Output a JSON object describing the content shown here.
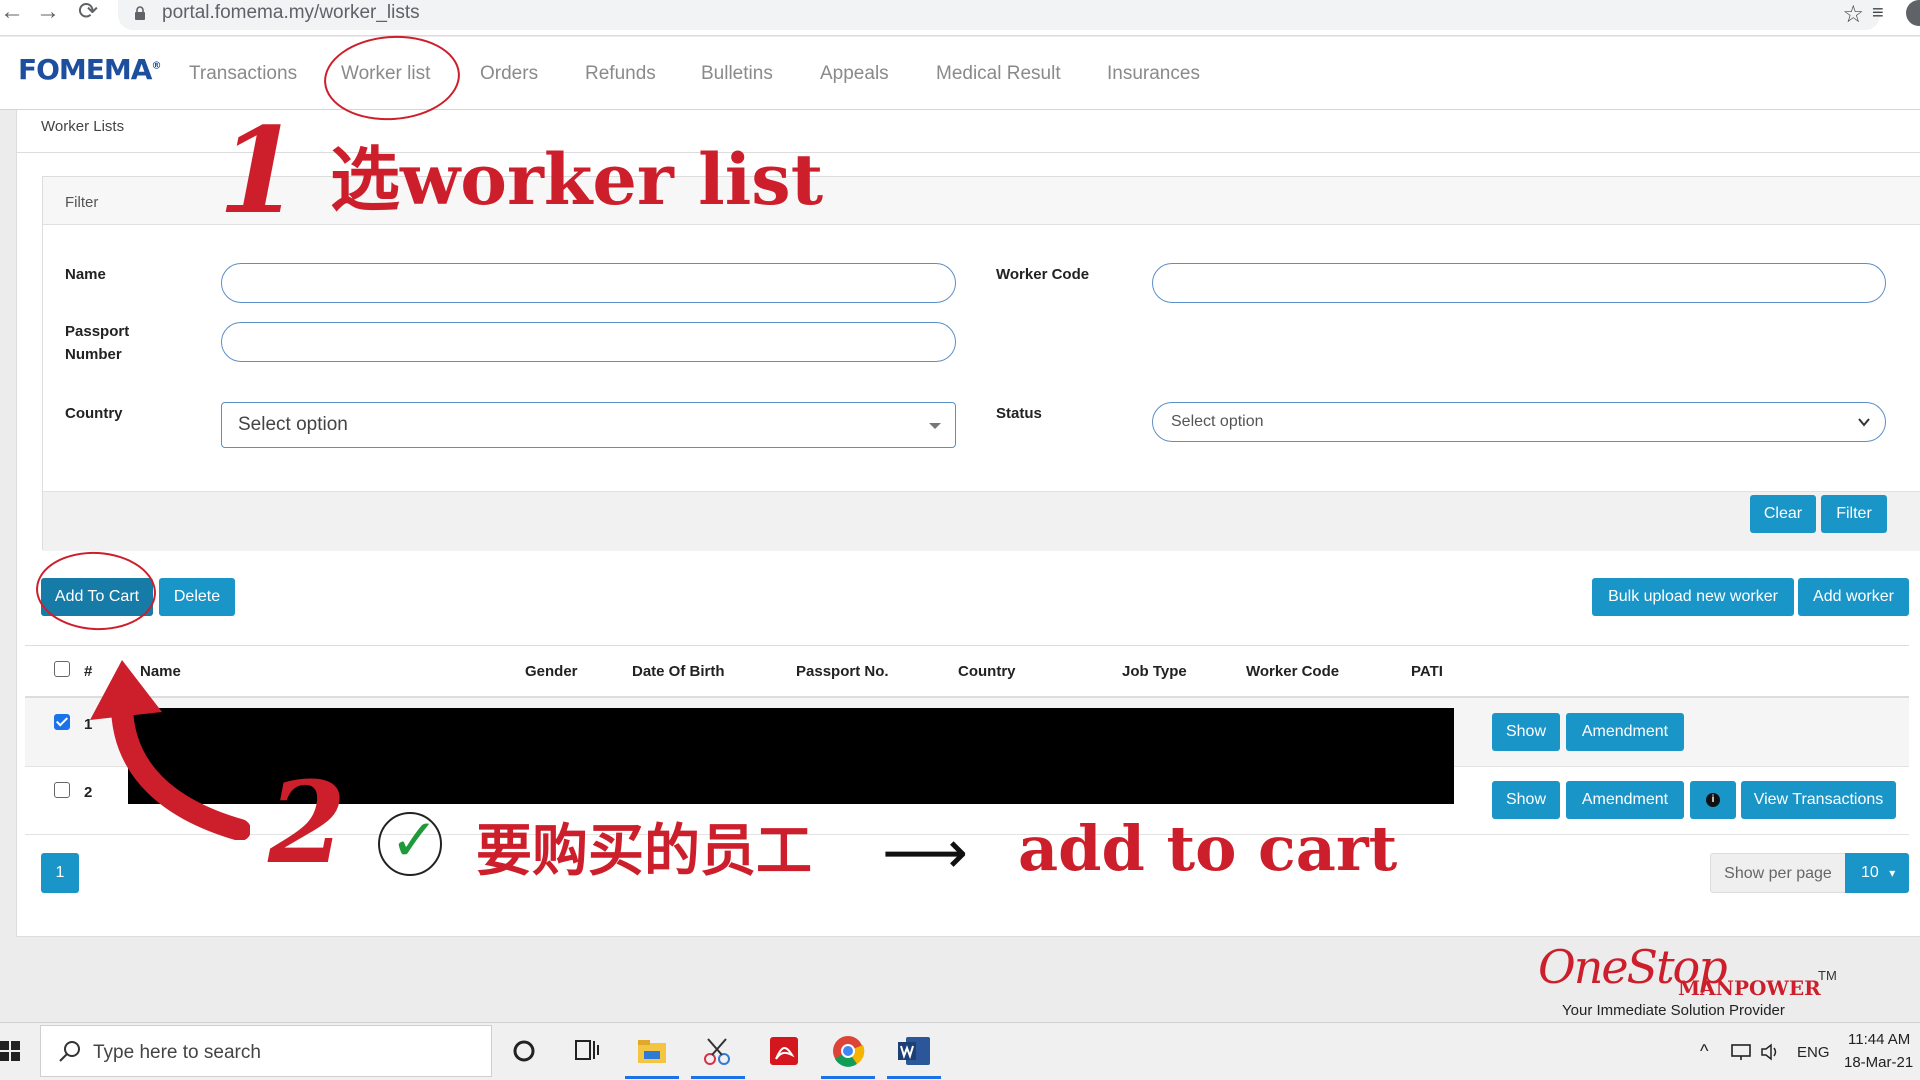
{
  "browser": {
    "back_glyph": "←",
    "forward_glyph": "→",
    "reload_glyph": "⟳",
    "url": "portal.fomema.my/worker_lists",
    "star_glyph": "☆",
    "ext_glyph": "≡"
  },
  "topnav": {
    "logo": "FOMEMA",
    "logo_mark": "®",
    "items": [
      "Transactions",
      "Worker list",
      "Orders",
      "Refunds",
      "Bulletins",
      "Appeals",
      "Medical Result",
      "Insurances"
    ]
  },
  "breadcrumb": "Worker Lists",
  "filter": {
    "title": "Filter",
    "name_label": "Name",
    "worker_code_label": "Worker Code",
    "passport_label_1": "Passport",
    "passport_label_2": "Number",
    "country_label": "Country",
    "country_value": "Select option",
    "status_label": "Status",
    "status_value": "Select option",
    "clear_label": "Clear",
    "filter_label": "Filter"
  },
  "actions": {
    "add_to_cart": "Add To Cart",
    "delete": "Delete",
    "bulk_upload": "Bulk upload new worker",
    "add_worker": "Add worker"
  },
  "table": {
    "headers": [
      "#",
      "Name",
      "Gender",
      "Date Of Birth",
      "Passport No.",
      "Country",
      "Job Type",
      "Worker Code",
      "PATI"
    ],
    "rows": [
      {
        "num": "1",
        "checked": true,
        "actions": [
          "Show",
          "Amendment"
        ]
      },
      {
        "num": "2",
        "checked": false,
        "actions": [
          "Show",
          "Amendment",
          "View Transactions"
        ]
      }
    ],
    "info_glyph": "i"
  },
  "pagination": {
    "current_page": "1",
    "per_page_label": "Show per page",
    "per_page_value": "10",
    "caret": "▾"
  },
  "annotations": {
    "step1_number": "1",
    "step1_text": "选worker list",
    "step2_number": "2",
    "check_glyph": "✓",
    "step2_text": "要购买的员工",
    "arrow_glyph": "⟶",
    "step2_action": "add to cart"
  },
  "watermark": {
    "logo": "OneStop",
    "manpower": "MANPOWER",
    "tm": "TM",
    "tagline": "Your Immediate Solution Provider"
  },
  "taskbar": {
    "search_placeholder": "Type here to search",
    "tray_chevron": "^",
    "language": "ENG",
    "time": "11:44 AM",
    "date": "18-Mar-21"
  },
  "colors": {
    "primary": "#1a95c8",
    "annotation_red": "#cc1f2b",
    "logo_blue": "#1d4f9e"
  }
}
